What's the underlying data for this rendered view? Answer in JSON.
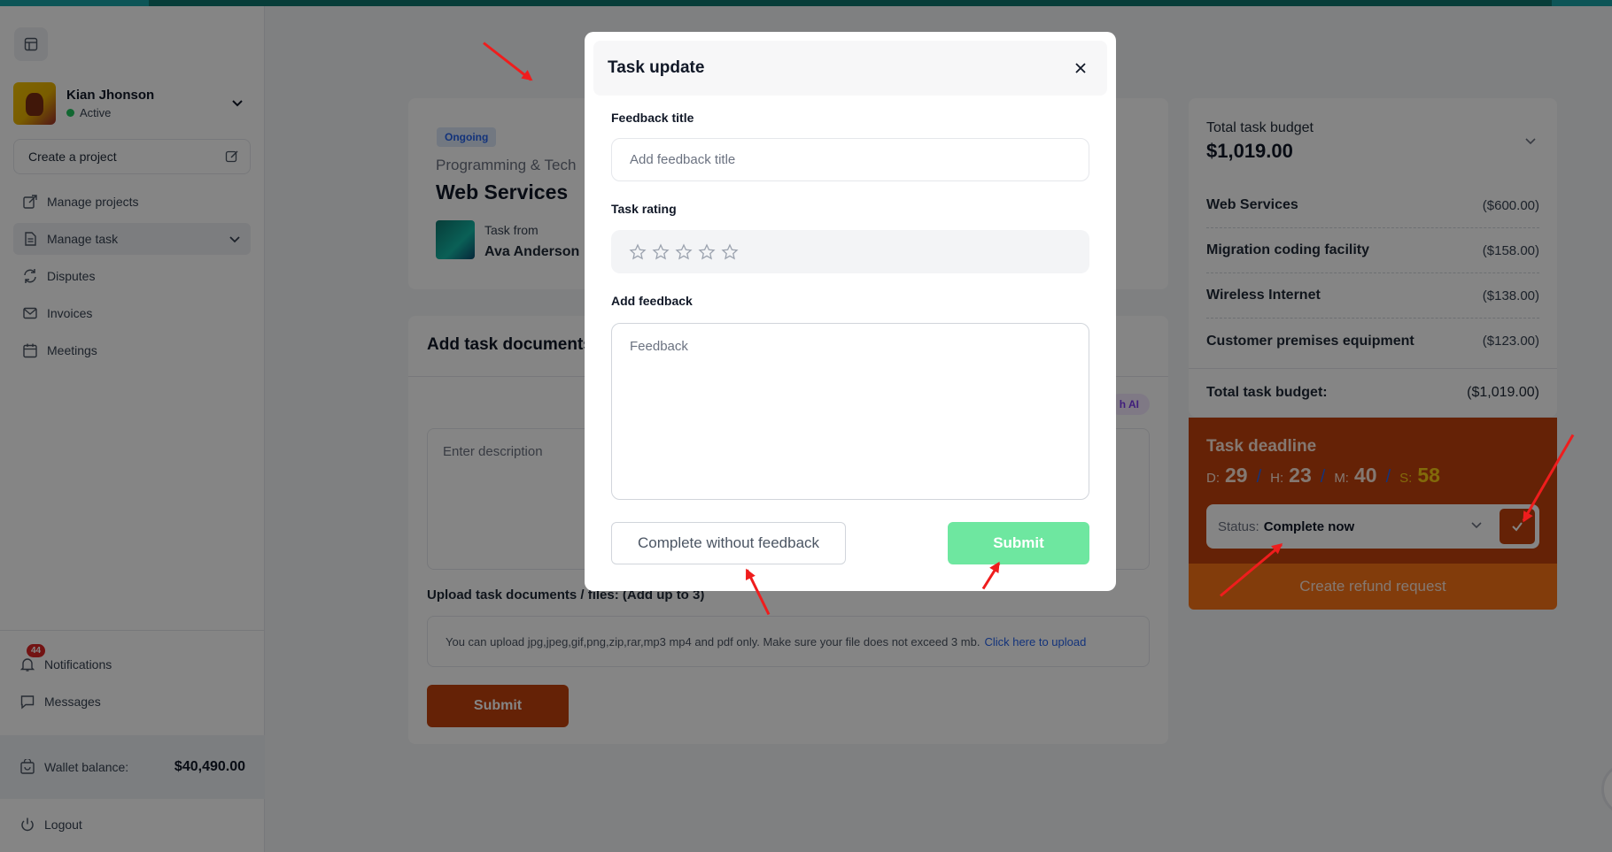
{
  "sidebar": {
    "user": {
      "name": "Kian Jhonson",
      "status": "Active"
    },
    "create_project": "Create a project",
    "nav": [
      {
        "label": "Manage projects",
        "icon": "external-link-icon"
      },
      {
        "label": "Manage task",
        "icon": "document-icon"
      },
      {
        "label": "Disputes",
        "icon": "refresh-icon"
      },
      {
        "label": "Invoices",
        "icon": "mail-icon"
      },
      {
        "label": "Meetings",
        "icon": "calendar-icon"
      }
    ],
    "notifications": {
      "label": "Notifications",
      "count": "44"
    },
    "messages": "Messages",
    "wallet": {
      "label": "Wallet balance:",
      "amount": "$40,490.00"
    },
    "logout": "Logout"
  },
  "project": {
    "tag": "Ongoing",
    "category": "Programming & Tech",
    "title": "Web Services",
    "from_label": "Task from",
    "client": "Ava Anderson"
  },
  "documents": {
    "title": "Add task documents",
    "ai_pill": "h AI",
    "description_placeholder": "Enter description",
    "upload_label": "Upload task documents / files: (Add up to 3)",
    "upload_hint": "You can upload jpg,jpeg,gif,png,zip,rar,mp3 mp4 and pdf only. Make sure your file does not exceed 3 mb.",
    "upload_link": "Click here to upload",
    "submit": "Submit"
  },
  "budget": {
    "label": "Total task budget",
    "total": "$1,019.00",
    "items": [
      {
        "name": "Web Services",
        "amount": "($600.00)"
      },
      {
        "name": "Migration coding facility",
        "amount": "($158.00)"
      },
      {
        "name": "Wireless Internet",
        "amount": "($138.00)"
      },
      {
        "name": "Customer premises equipment",
        "amount": "($123.00)"
      }
    ],
    "total_label": "Total task budget:",
    "total_amount": "($1,019.00)"
  },
  "deadline": {
    "title": "Task deadline",
    "d_label": "D:",
    "d": "29",
    "h_label": "H:",
    "h": "23",
    "m_label": "M:",
    "m": "40",
    "s_label": "S:",
    "s": "58",
    "status_label": "Status:",
    "status_value": "Complete now",
    "refund": "Create refund request"
  },
  "modal": {
    "title": "Task update",
    "feedback_title_label": "Feedback title",
    "feedback_title_placeholder": "Add feedback title",
    "rating_label": "Task rating",
    "rating_value": 0,
    "rating_max": 5,
    "feedback_label": "Add feedback",
    "feedback_placeholder": "Feedback",
    "complete_without": "Complete without feedback",
    "submit": "Submit"
  },
  "colors": {
    "accent": "#c2410c",
    "submit_green": "#6ee7a0",
    "annotation_arrow": "#ef1d1d"
  }
}
